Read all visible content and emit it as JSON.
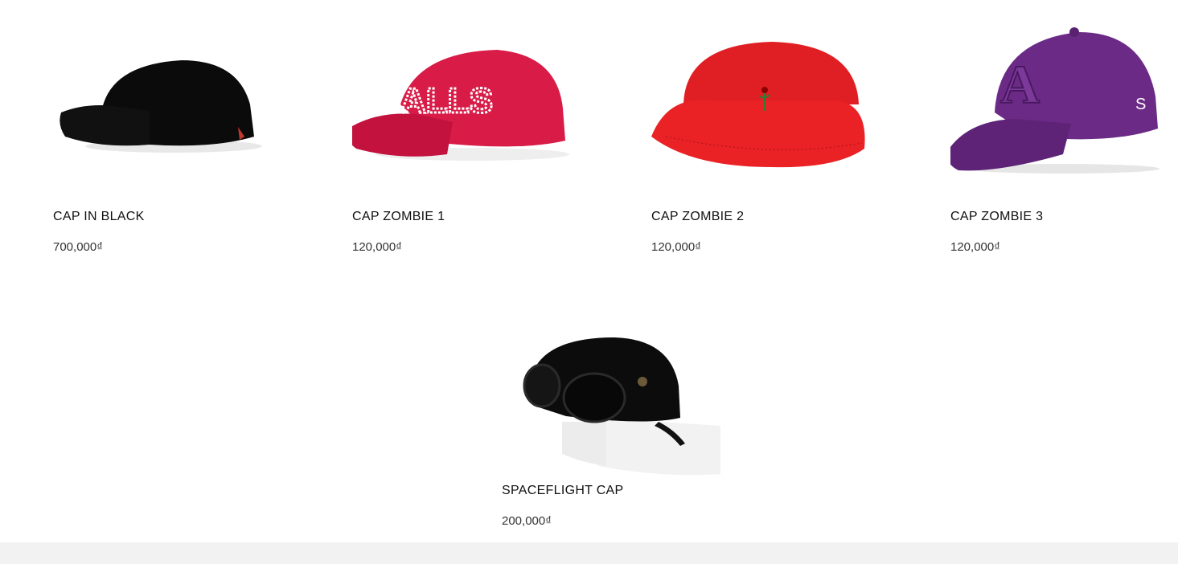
{
  "products": [
    {
      "name": "CAP IN BLACK",
      "price": "700,000₫",
      "image_icon": "black-cap-image"
    },
    {
      "name": "CAP ZOMBIE 1",
      "price": "120,000₫",
      "image_icon": "red-satin-cap-image",
      "embroidery_text": "ALLS"
    },
    {
      "name": "CAP ZOMBIE 2",
      "price": "120,000₫",
      "image_icon": "red-bucket-hat-image"
    },
    {
      "name": "CAP ZOMBIE 3",
      "price": "120,000₫",
      "image_icon": "purple-cap-image",
      "logo_letter": "A",
      "side_letter": "S"
    },
    {
      "name": "SPACEFLIGHT CAP",
      "price": "200,000₫",
      "image_icon": "goggle-cap-image"
    }
  ],
  "colors": {
    "background": "#ffffff",
    "footer_band": "#f2f2f2",
    "text": "#111111"
  }
}
